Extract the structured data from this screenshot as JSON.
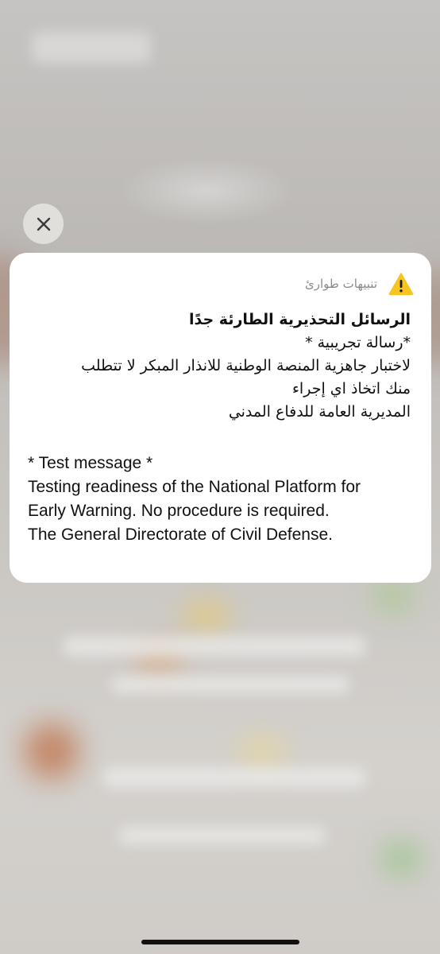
{
  "notification": {
    "app_name": "تنبيهات طوارئ",
    "app_icon": "warning-triangle-icon",
    "title": "الرسائل التحذيرية الطارئة جدًا",
    "arabic_lines": [
      "*رسالة تجريبية *",
      "لاختبار جاهزية المنصة الوطنية  للانذار المبكر لا تتطلب",
      "منك اتخاذ اي إجراء",
      "المديرية العامة للدفاع المدني"
    ],
    "english_lines": [
      "* Test message *",
      "Testing readiness of the National Platform for",
      "Early Warning. No procedure is required.",
      "The General Directorate of Civil Defense."
    ]
  },
  "close_button": {
    "icon": "close-icon"
  },
  "colors": {
    "card_background": "#ffffff",
    "warning_yellow": "#f7c521",
    "secondary_text": "#8a8a8e",
    "primary_text": "#111111"
  }
}
